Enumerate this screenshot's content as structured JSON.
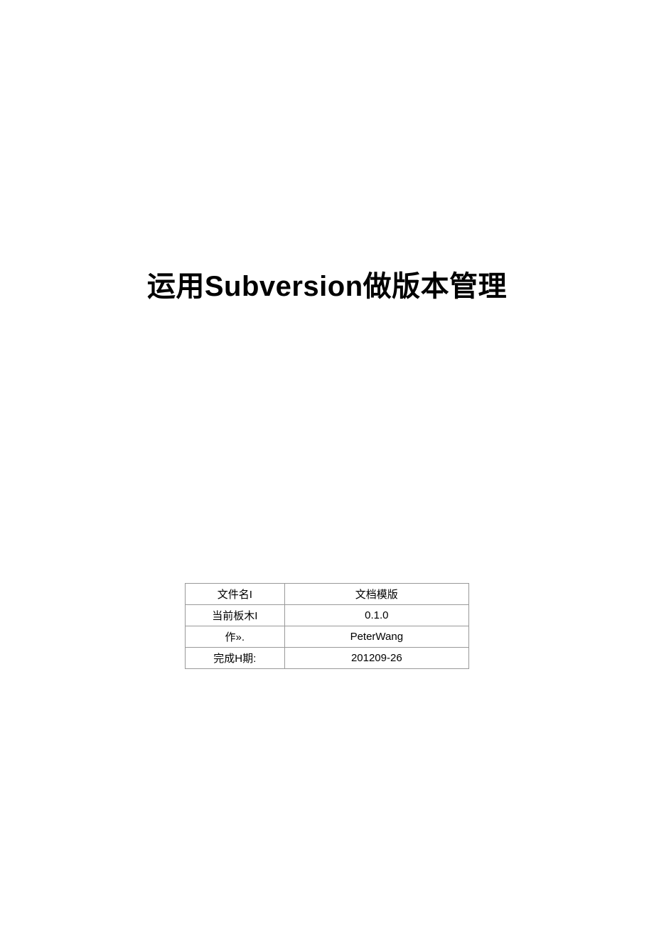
{
  "document": {
    "title_prefix": "运用",
    "title_latin": "Subversion",
    "title_suffix": "做版本管理",
    "info_rows": [
      {
        "label": "文件名I",
        "value": "文档模版"
      },
      {
        "label": "当前板木I",
        "value": "0.1.0"
      },
      {
        "label": "作».",
        "value": "PeterWang"
      },
      {
        "label": "完成H期:",
        "value": "201209-26"
      }
    ]
  }
}
